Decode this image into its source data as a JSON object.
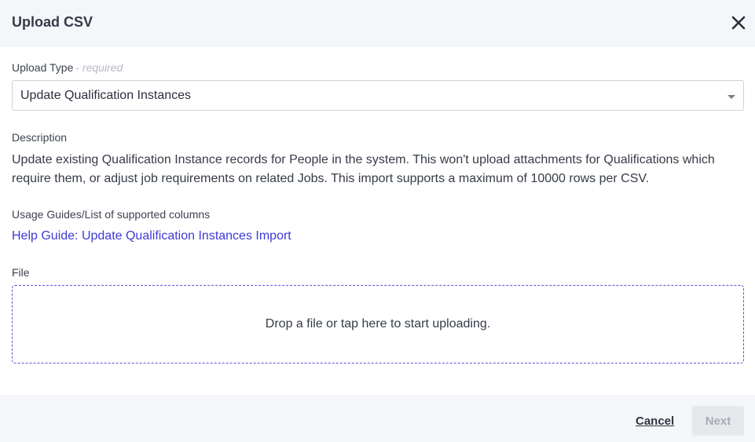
{
  "dialog": {
    "title": "Upload CSV",
    "close_icon": "close-icon"
  },
  "upload_type": {
    "label": "Upload Type",
    "required_hint": "- required",
    "selected_value": "Update Qualification Instances",
    "caret_icon": "chevron-down-icon"
  },
  "description": {
    "label": "Description",
    "text": "Update existing Qualification Instance records for People in the system. This won't upload attachments for Qualifications which require them, or adjust job requirements on related Jobs. This import supports a maximum of 10000 rows per CSV."
  },
  "usage_guides": {
    "label": "Usage Guides/List of supported columns",
    "link_text": "Help Guide: Update Qualification Instances Import"
  },
  "file": {
    "label": "File",
    "dropzone_text": "Drop a file or tap here to start uploading."
  },
  "footer": {
    "cancel_label": "Cancel",
    "next_label": "Next"
  },
  "colors": {
    "link": "#3d3ad6",
    "dropzone_border": "#5b50d6",
    "header_bg": "#f5f6f9",
    "disabled_button_bg": "#e6e8ec"
  }
}
